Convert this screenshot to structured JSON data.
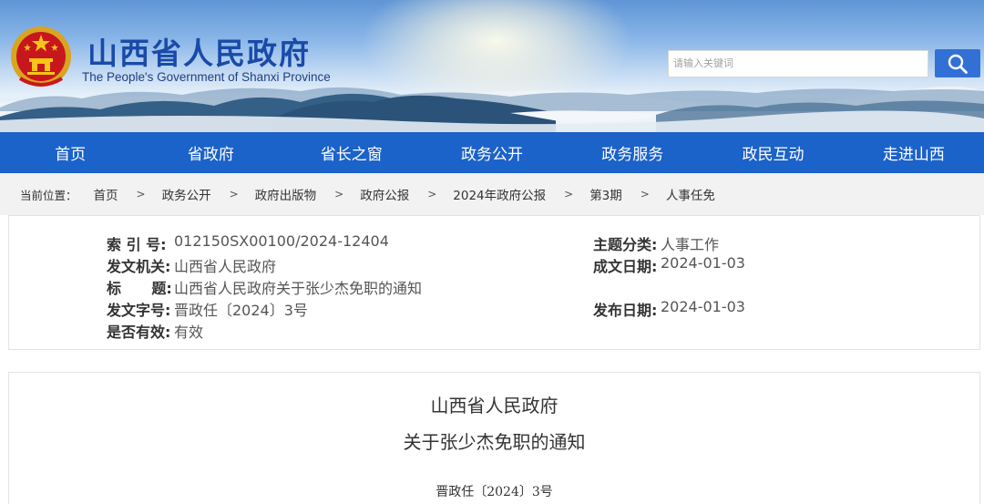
{
  "header": {
    "title": "山西省人民政府",
    "subtitle": "The People's Government of Shanxi Province",
    "emblem_icon": "national-emblem-icon",
    "search": {
      "placeholder": "请输入关键词",
      "button_icon": "search-icon"
    }
  },
  "nav": {
    "items": [
      {
        "label": "首页"
      },
      {
        "label": "省政府"
      },
      {
        "label": "省长之窗"
      },
      {
        "label": "政务公开"
      },
      {
        "label": "政务服务"
      },
      {
        "label": "政民互动"
      },
      {
        "label": "走进山西"
      }
    ]
  },
  "breadcrumb": {
    "label": "当前位置：",
    "items": [
      "首页",
      "政务公开",
      "政府出版物",
      "政府公报",
      "2024年政府公报",
      "第3期",
      "人事任免"
    ],
    "separator": ">"
  },
  "meta": {
    "index_no": {
      "key": "索  引 号:",
      "value": "012150SX00100/2024-12404"
    },
    "topic": {
      "key": "主题分类:",
      "value": "人事工作"
    },
    "issuer": {
      "key": "发文机关:",
      "value": "山西省人民政府"
    },
    "created": {
      "key": "成文日期:",
      "value": "2024-01-03"
    },
    "title": {
      "key": "标      题:",
      "value": "山西省人民政府关于张少杰免职的通知"
    },
    "doc_no": {
      "key": "发文字号:",
      "value": "晋政任〔2024〕3号"
    },
    "published": {
      "key": "发布日期:",
      "value": "2024-01-03"
    },
    "valid": {
      "key": "是否有效:",
      "value": "有效"
    }
  },
  "document": {
    "title_line1": "山西省人民政府",
    "title_line2": "关于张少杰免职的通知",
    "number": "晋政任〔2024〕3号"
  },
  "colors": {
    "nav_bg": "#1b62c9",
    "title_blue": "#1a4aa8",
    "search_button": "#3270d6",
    "breadcrumb_bg": "#f2f2f2"
  }
}
